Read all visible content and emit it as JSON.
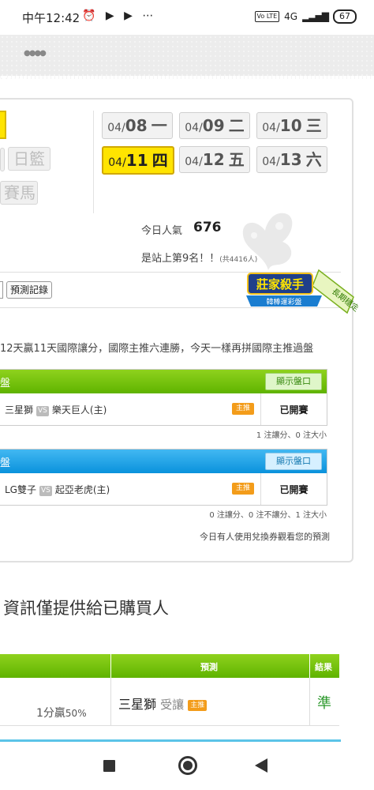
{
  "status_bar": {
    "time": "中午12:42",
    "icons": "⏰ ▶ ▶ ⋯",
    "lte": "Vo LTE",
    "network": "4G",
    "battery": "67"
  },
  "top": {
    "left_tabs": [
      "日籃",
      "賽馬"
    ],
    "dates": [
      {
        "md": "04/",
        "d": "08",
        "w": "一"
      },
      {
        "md": "04/",
        "d": "09",
        "w": "二"
      },
      {
        "md": "04/",
        "d": "10",
        "w": "三"
      },
      {
        "md": "04/",
        "d": "11",
        "w": "四"
      },
      {
        "md": "04/",
        "d": "12",
        "w": "五"
      },
      {
        "md": "04/",
        "d": "13",
        "w": "六"
      }
    ],
    "popularity_label": "今日人氣",
    "popularity_value": "676",
    "rank_text": "是站上第9名！！",
    "rank_total": "(共4416人)"
  },
  "toolbar": {
    "record_button": "預測記錄",
    "badge_title": "莊家殺手",
    "badge_sub": "韓棒運彩盤",
    "badge_ribbon": "長期穩定"
  },
  "announcement": "12天贏11天國際讓分，國際主推六連勝，今天一樣再拼國際主推過盤",
  "panels": [
    {
      "head_label": "盤",
      "show_button": "顯示盤口",
      "away": "三星獅",
      "vs": "VS",
      "home": "樂天巨人(主)",
      "tag": "主推",
      "status": "已開賽",
      "summary": "1 注讓分、0 注大小"
    },
    {
      "head_label": "盤",
      "show_button": "顯示盤口",
      "away": "LG雙子",
      "vs": "VS",
      "home": "起亞老虎(主)",
      "tag": "主推",
      "status": "已開賽",
      "summary": "0 注讓分、0 注不讓分、1 注大小"
    }
  ],
  "notice": "今日有人使用兌換券觀看您的預測",
  "info_title": "資訊僅提供給已購買人",
  "table": {
    "headers": [
      "預測",
      "結果"
    ],
    "rate": "1分贏",
    "rate_pct": "50%",
    "prediction_team": "三星獅",
    "prediction_type": "受讓",
    "prediction_tag": "主推",
    "result": "準"
  },
  "colors": {
    "accent_yellow": "#ffe400",
    "green_header": "#5fb300",
    "blue_header": "#0a92dc",
    "tag_orange": "#f39c1a",
    "result_green": "#2e9a2e"
  }
}
